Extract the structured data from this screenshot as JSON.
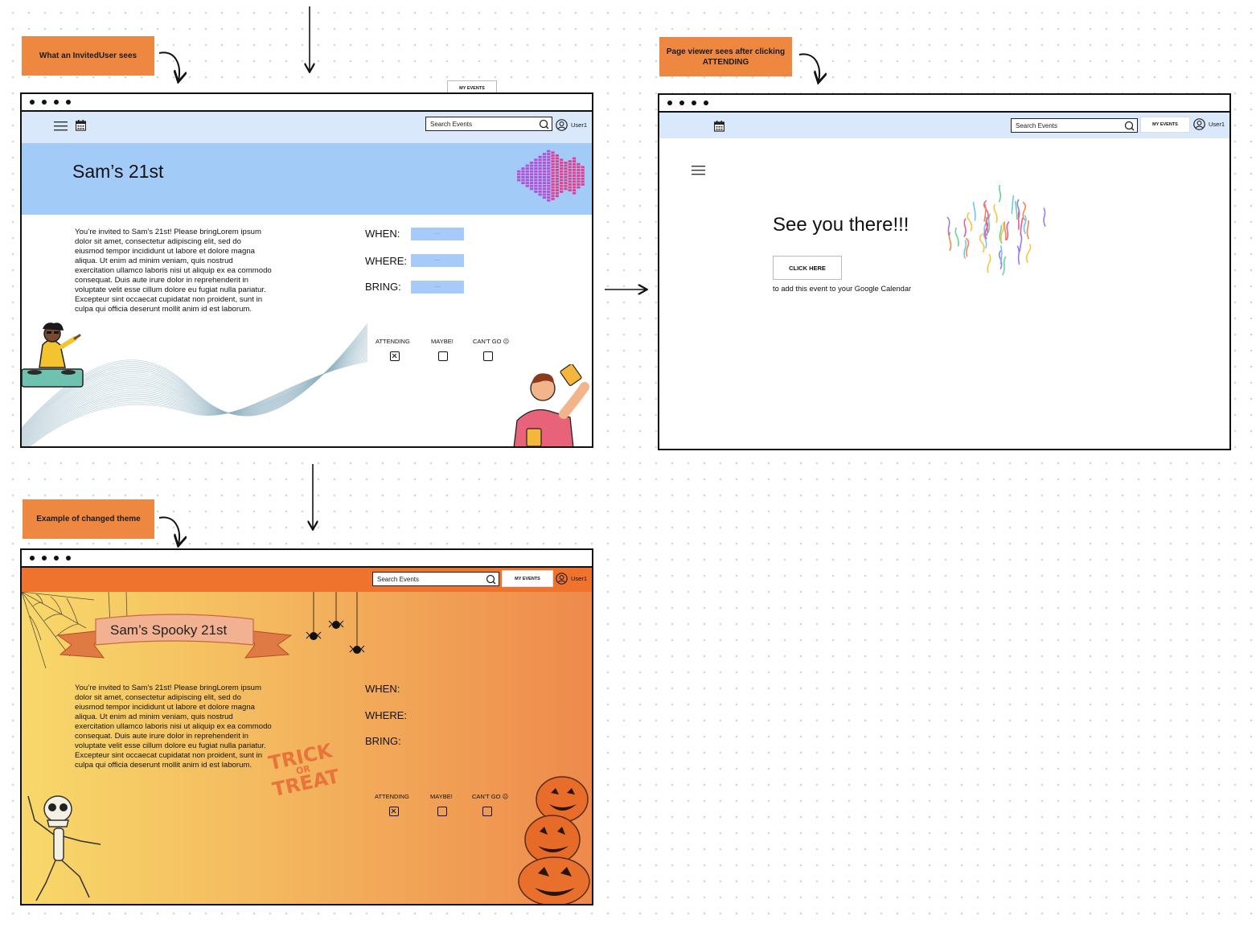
{
  "annotations": {
    "invited_user": "What an InvitedUser sees",
    "after_attending": "Page viewer sees after clicking ATTENDING",
    "changed_theme": "Example of changed theme"
  },
  "frame1": {
    "floating_tab": "MY EVENTS",
    "search_placeholder": "Search Events",
    "user_label": "User1",
    "event_title": "Sam’s 21st",
    "description": "You’re invited to Sam’s 21st! Please bringLorem ipsum dolor sit amet, consectetur adipiscing elit, sed do eiusmod tempor incididunt ut labore et dolore magna aliqua. Ut enim ad minim veniam, quis nostrud exercitation ullamco laboris nisi ut aliquip ex ea commodo consequat. Duis aute irure dolor in reprehenderit in voluptate velit esse cillum dolore eu fugiat nulla pariatur. Excepteur sint occaecat cupidatat non proident, sunt in culpa qui officia deserunt mollit anim id est laborum.",
    "when_label": "WHEN:",
    "where_label": "WHERE:",
    "bring_label": "BRING:",
    "field_placeholder": "—",
    "attending_label": "ATTENDING",
    "maybe_label": "MAYBE!",
    "cant_go_label": "CAN'T GO ☹",
    "attending_checked": true
  },
  "frame2": {
    "search_placeholder": "Search Events",
    "my_events_label": "MY EVENTS",
    "user_label": "User1",
    "heading": "See you there!!!",
    "click_here_label": "CLICK HERE",
    "calendar_text": "to add  this event to your Google Calendar"
  },
  "frame3": {
    "search_placeholder": "Search Events",
    "my_events_label": "MY EVENTS",
    "user_label": "User1",
    "event_title": "Sam’s Spooky 21st",
    "description": "You’re invited to Sam’s 21st! Please bringLorem ipsum dolor sit amet, consectetur adipiscing elit, sed do eiusmod tempor incididunt ut labore et dolore magna aliqua. Ut enim ad minim veniam, quis nostrud exercitation ullamco laboris nisi ut aliquip ex ea commodo consequat. Duis aute irure dolor in reprehenderit in voluptate velit esse cillum dolore eu fugiat nulla pariatur. Excepteur sint occaecat cupidatat non proident, sunt in culpa qui officia deserunt mollit anim id est laborum.",
    "when_label": "WHEN:",
    "where_label": "WHERE:",
    "bring_label": "BRING:",
    "trick_or_treat": [
      "TRICK",
      "OR",
      "TREAT"
    ],
    "attending_label": "ATTENDING",
    "maybe_label": "MAYBE!",
    "cant_go_label": "CAN'T GO ☹",
    "attending_checked": true
  },
  "colors": {
    "annotation": "#ee8841",
    "navbar_light": "#d9e8fb",
    "banner_blue": "#a3cbf8",
    "field_blue": "#a6cbf8",
    "navbar_orange": "#ef722d",
    "theme_gradient_start": "#f8d86a",
    "theme_gradient_end": "#ee8a4c"
  }
}
